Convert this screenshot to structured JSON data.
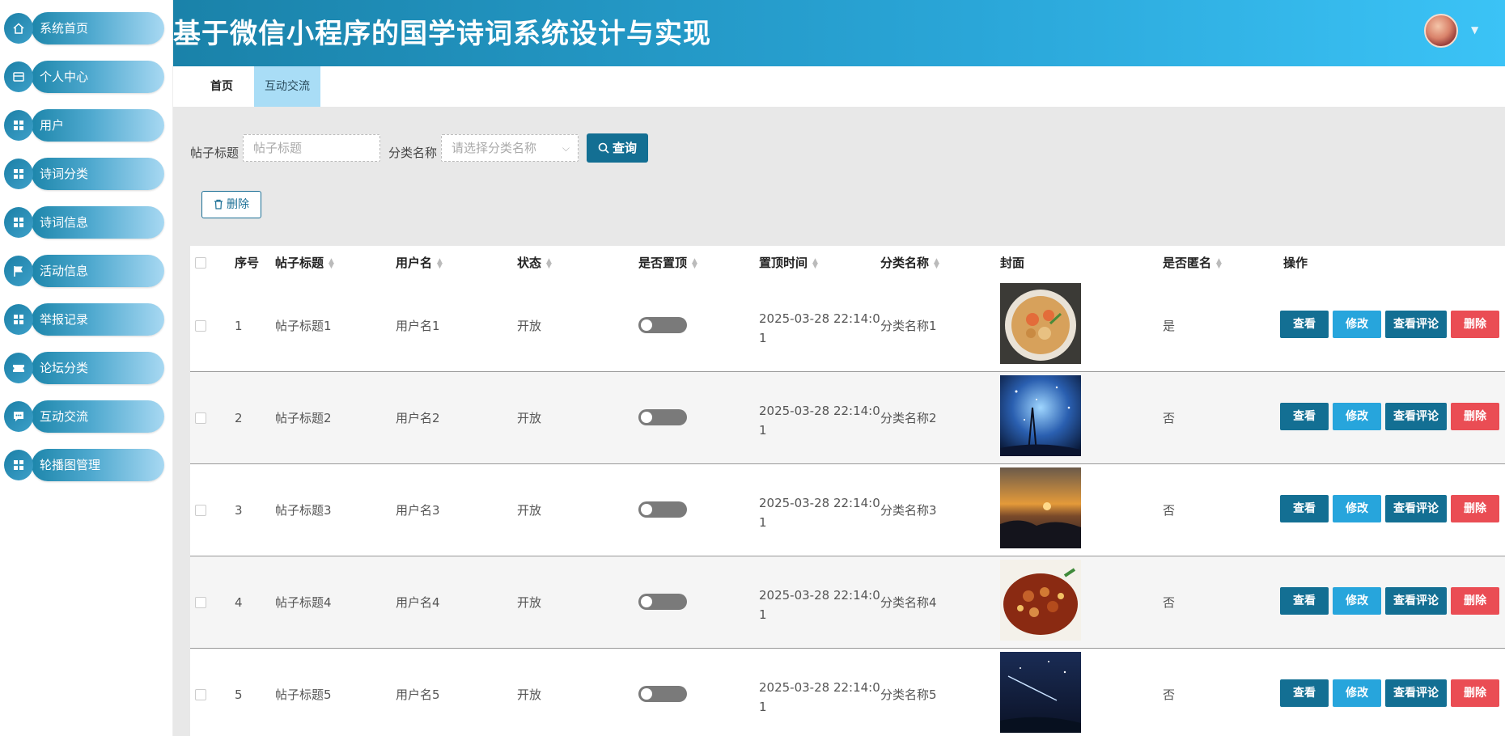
{
  "header": {
    "title": "基于微信小程序的国学诗词系统设计与实现"
  },
  "sidebar": {
    "items": [
      {
        "label": "系统首页",
        "icon": "home-icon"
      },
      {
        "label": "个人中心",
        "icon": "wallet-icon"
      },
      {
        "label": "用户",
        "icon": "grid-icon"
      },
      {
        "label": "诗词分类",
        "icon": "grid-icon"
      },
      {
        "label": "诗词信息",
        "icon": "grid-icon"
      },
      {
        "label": "活动信息",
        "icon": "flag-icon"
      },
      {
        "label": "举报记录",
        "icon": "grid-icon"
      },
      {
        "label": "论坛分类",
        "icon": "ticket-icon"
      },
      {
        "label": "互动交流",
        "icon": "chat-icon"
      },
      {
        "label": "轮播图管理",
        "icon": "grid-icon"
      }
    ]
  },
  "tabs": {
    "home": "首页",
    "active": "互动交流"
  },
  "search": {
    "title_label": "帖子标题",
    "title_placeholder": "帖子标题",
    "category_label": "分类名称",
    "category_placeholder": "请选择分类名称",
    "query_button": "查询"
  },
  "toolbar": {
    "delete_button": "删除"
  },
  "table": {
    "headers": {
      "index": "序号",
      "title": "帖子标题",
      "username": "用户名",
      "status": "状态",
      "pinned": "是否置顶",
      "pin_time": "置顶时间",
      "category": "分类名称",
      "cover": "封面",
      "anonymous": "是否匿名",
      "actions": "操作"
    },
    "rows": [
      {
        "index": "1",
        "title": "帖子标题1",
        "username": "用户名1",
        "status": "开放",
        "pin_time": "2025-03-28 22:14:01",
        "category": "分类名称1",
        "anonymous": "是",
        "cover": "food-shrimp-pasta"
      },
      {
        "index": "2",
        "title": "帖子标题2",
        "username": "用户名2",
        "status": "开放",
        "pin_time": "2025-03-28 22:14:01",
        "category": "分类名称2",
        "anonymous": "否",
        "cover": "starry-sky"
      },
      {
        "index": "3",
        "title": "帖子标题3",
        "username": "用户名3",
        "status": "开放",
        "pin_time": "2025-03-28 22:14:01",
        "category": "分类名称3",
        "anonymous": "否",
        "cover": "sunset-sea"
      },
      {
        "index": "4",
        "title": "帖子标题4",
        "username": "用户名4",
        "status": "开放",
        "pin_time": "2025-03-28 22:14:01",
        "category": "分类名称4",
        "anonymous": "否",
        "cover": "food-chicken-dish"
      },
      {
        "index": "5",
        "title": "帖子标题5",
        "username": "用户名5",
        "status": "开放",
        "pin_time": "2025-03-28 22:14:01",
        "category": "分类名称5",
        "anonymous": "否",
        "cover": "night-sky-meteor"
      }
    ],
    "row_actions": {
      "view": "查看",
      "edit": "修改",
      "comments": "查看评论",
      "delete": "删除"
    }
  },
  "colors": {
    "primary": "#136f93",
    "accent": "#27a5dc",
    "danger": "#ea4d54",
    "tab_active": "#a9ddf6"
  }
}
